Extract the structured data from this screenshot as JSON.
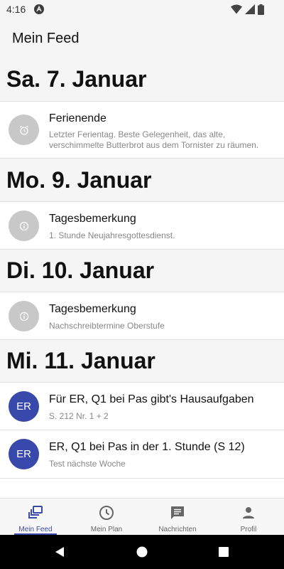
{
  "status_bar": {
    "time": "4:16",
    "icons": [
      "app-notification-icon",
      "wifi-icon",
      "signal-icon",
      "battery-icon"
    ]
  },
  "app_bar": {
    "title": "Mein Feed"
  },
  "feed": {
    "sections": [
      {
        "date": "Sa. 7. Januar",
        "items": [
          {
            "icon": "alarm-icon",
            "title": "Ferienende",
            "subtitle": "Letzter Ferientag. Beste Gelegenheit, das alte, verschimmelte Butterbrot aus dem Tornister zu räumen."
          }
        ]
      },
      {
        "date": "Mo. 9. Januar",
        "items": [
          {
            "icon": "info-icon",
            "title": "Tagesbemerkung",
            "subtitle": "1. Stunde Neujahresgottesdienst."
          }
        ]
      },
      {
        "date": "Di. 10. Januar",
        "items": [
          {
            "icon": "info-icon",
            "title": "Tagesbemerkung",
            "subtitle": "Nachschreibtermine Oberstufe"
          }
        ]
      },
      {
        "date": "Mi. 11. Januar",
        "items": [
          {
            "avatar_text": "ER",
            "title": "Für ER, Q1 bei Pas gibt's Hausaufgaben",
            "subtitle": "S. 212 Nr. 1 + 2"
          },
          {
            "avatar_text": "ER",
            "title": "ER, Q1 bei Pas in der 1. Stunde (S 12)",
            "subtitle": "Test nächste Woche"
          }
        ]
      }
    ]
  },
  "bottom_nav": {
    "items": [
      {
        "label": "Mein Feed",
        "icon": "feed-icon",
        "active": true
      },
      {
        "label": "Mein Plan",
        "icon": "clock-icon",
        "active": false
      },
      {
        "label": "Nachrichten",
        "icon": "message-icon",
        "active": false
      },
      {
        "label": "Profil",
        "icon": "person-icon",
        "active": false
      }
    ]
  },
  "colors": {
    "accent": "#3949ab",
    "background": "#f5f5f5",
    "card": "#ffffff",
    "placeholder_avatar": "#c8c8c8",
    "subtitle_text": "#888888"
  }
}
